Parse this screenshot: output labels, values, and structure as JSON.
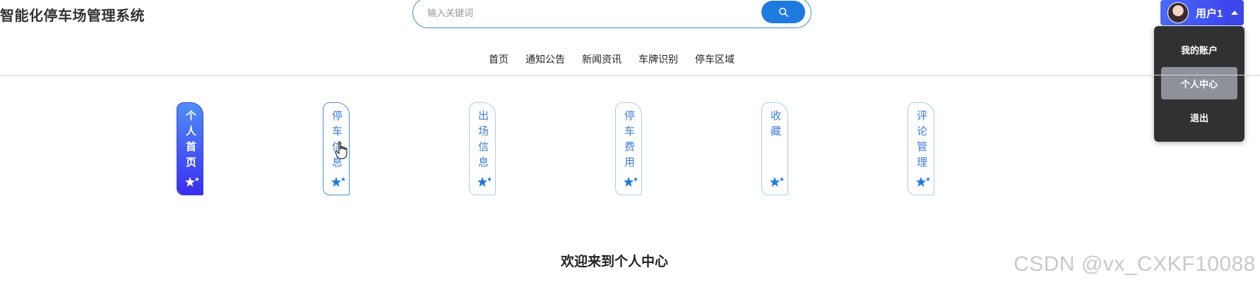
{
  "header": {
    "site_title": "智能化停车场管理系统",
    "search_placeholder": "输入关键词",
    "search_icon": "search-icon",
    "user_name": "用户1",
    "caret_icon": "caret-up-icon"
  },
  "user_menu": {
    "items": [
      {
        "label": "我的账户"
      },
      {
        "label": "个人中心"
      },
      {
        "label": "退出"
      }
    ]
  },
  "nav": {
    "items": [
      {
        "label": "首页"
      },
      {
        "label": "通知公告"
      },
      {
        "label": "新闻资讯"
      },
      {
        "label": "车牌识别"
      },
      {
        "label": "停车区域"
      }
    ]
  },
  "side_tabs": {
    "items": [
      {
        "label": "个人首页",
        "active": true
      },
      {
        "label": "停车信息"
      },
      {
        "label": "出场信息"
      },
      {
        "label": "停车费用"
      },
      {
        "label": "收藏"
      },
      {
        "label": "评论管理"
      }
    ]
  },
  "main": {
    "welcome": "欢迎来到个人中心"
  },
  "watermark": "CSDN @vx_CXKF10088",
  "colors": {
    "accent": "#1f7ae0",
    "user_button": "#4b6bf5",
    "dropdown_bg": "#303133",
    "dropdown_active": "#8e9199",
    "tab_text": "#3b7dd8"
  }
}
